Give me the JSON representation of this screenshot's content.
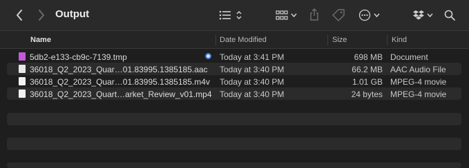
{
  "window": {
    "title": "Output"
  },
  "icons": {
    "back": "chevron-left-icon",
    "forward": "chevron-right-icon",
    "list_view": "list-icon",
    "sort": "sort-icon",
    "group": "grid-icon",
    "share": "share-icon",
    "tag": "tag-icon",
    "more": "ellipsis-circle-icon",
    "dropbox": "dropbox-icon",
    "search": "search-icon"
  },
  "columns": {
    "name": "Name",
    "date_modified": "Date Modified",
    "size": "Size",
    "kind": "Kind"
  },
  "files": [
    {
      "name": "5db2-e133-cb9c-7139.tmp",
      "date": "Today at 3:41 PM",
      "size": "698 MB",
      "kind": "Document",
      "icon": "document-icon",
      "color": "#c35ad6"
    },
    {
      "name": "36018_Q2_2023_Quar…01.83995.1385185.aac",
      "date": "Today at 3:40 PM",
      "size": "66.2 MB",
      "kind": "AAC Audio File",
      "icon": "audio-file-icon",
      "color": "#e8e8e8"
    },
    {
      "name": "36018_Q2_2023_Quar…01.83995.1385185.m4v",
      "date": "Today at 3:40 PM",
      "size": "1.01 GB",
      "kind": "MPEG-4 movie",
      "icon": "movie-file-icon",
      "color": "#f2f2f2"
    },
    {
      "name": "36018_Q2_2023_Quart…arket_Review_v01.mp4",
      "date": "Today at 3:40 PM",
      "size": "24 bytes",
      "kind": "MPEG-4 movie",
      "icon": "movie-file-icon",
      "color": "#f2f2f2"
    }
  ]
}
